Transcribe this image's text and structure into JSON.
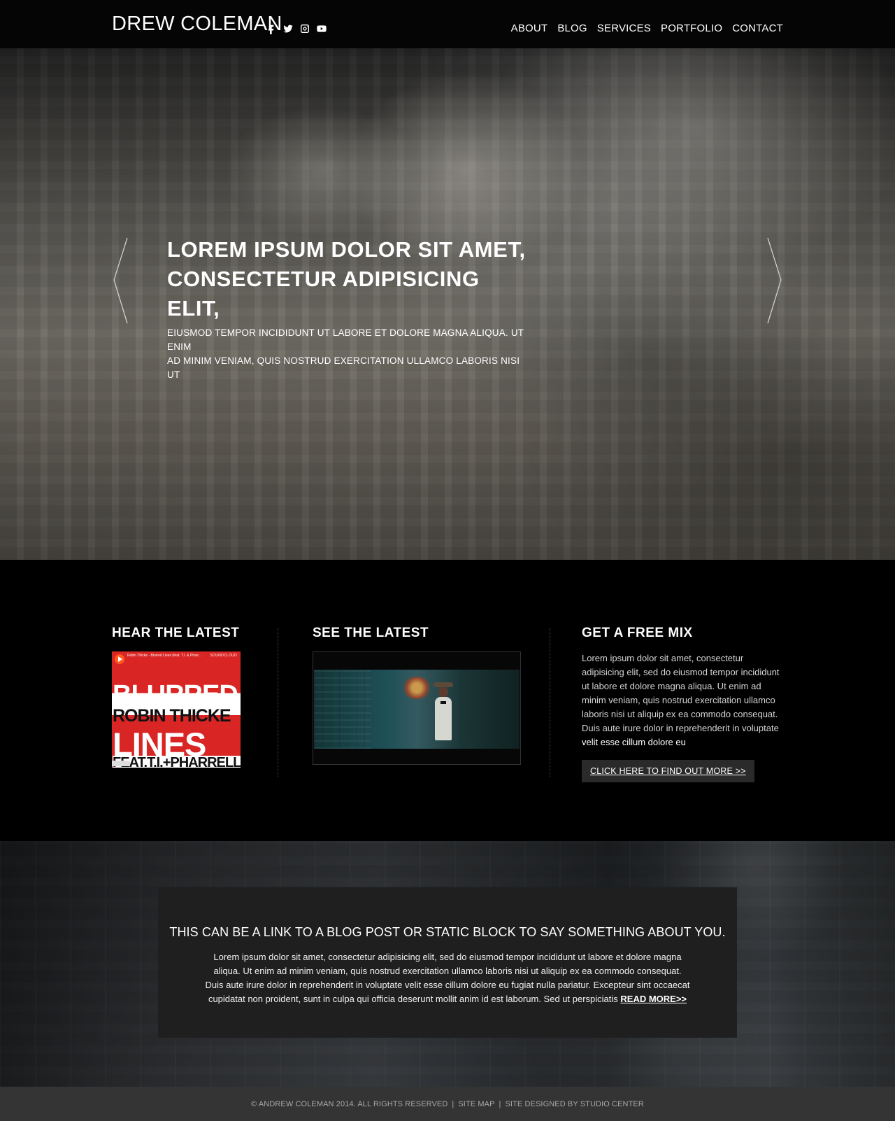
{
  "header": {
    "brand": "DREW COLEMAN",
    "social": [
      {
        "name": "facebook",
        "icon": "facebook-icon"
      },
      {
        "name": "twitter",
        "icon": "twitter-icon"
      },
      {
        "name": "instagram",
        "icon": "instagram-icon"
      },
      {
        "name": "youtube",
        "icon": "youtube-icon"
      }
    ],
    "nav": [
      "ABOUT",
      "BLOG",
      "SERVICES",
      "PORTFOLIO",
      "CONTACT"
    ]
  },
  "hero": {
    "title_line_1": "LOREM IPSUM DOLOR SIT AMET,",
    "title_line_2": "CONSECTETUR ADIPISICING ELIT,",
    "subtitle_line_1": "EIUSMOD TEMPOR INCIDIDUNT UT LABORE ET DOLORE MAGNA ALIQUA. UT ENIM",
    "subtitle_line_2": "AD MINIM VENIAM, QUIS NOSTRUD EXERCITATION ULLAMCO LABORIS NISI UT",
    "left_arrow_icon": "chevron-left-icon",
    "right_arrow_icon": "chevron-right-icon"
  },
  "latest": {
    "hear": {
      "title": "HEAR THE LATEST",
      "player_meta": "Robin Thicke - Blurred Lines (feat. T.I. & Pharr...",
      "player_brand": "SOUNDCLOUD",
      "art_line_1": "BLURRED",
      "art_line_2": "ROBIN THICKE",
      "art_line_3": "LINES",
      "art_line_4": "feat.T.I.+PHARRELL"
    },
    "see": {
      "title": "SEE THE LATEST"
    },
    "mix": {
      "title": "GET A FREE MIX",
      "text_main": "Lorem ipsum dolor sit amet, consectetur adipisicing elit, sed do eiusmod tempor incididunt ut labore et dolore magna aliqua. Ut enim ad minim veniam, quis nostrud exercitation ullamco laboris nisi ut aliquip ex ea commodo consequat. Duis aute irure dolor in reprehenderit in voluptate",
      "text_highlight": "velit esse cillum dolore eu",
      "button_label": "CLICK HERE TO FIND OUT MORE >>"
    }
  },
  "feature": {
    "title": "THIS CAN BE A LINK TO A BLOG POST OR STATIC BLOCK TO SAY SOMETHING ABOUT YOU.",
    "text": "Lorem ipsum dolor sit amet, consectetur adipisicing elit, sed do eiusmod tempor incididunt ut labore et dolore magna aliqua. Ut enim ad minim veniam, quis nostrud exercitation ullamco laboris nisi ut aliquip ex ea commodo consequat. Duis aute irure dolor in reprehenderit in voluptate velit esse cillum dolore eu fugiat nulla pariatur. Excepteur sint occaecat cupidatat non proident, sunt in culpa qui officia deserunt mollit anim id est laborum. Sed ut perspiciatis",
    "read_more": "READ MORE>>"
  },
  "footer": {
    "copyright": "© ANDREW COLEMAN 2014. ALL RIGHTS RESERVED",
    "separator_1": "|",
    "site_map": "SITE MAP",
    "separator_2": "|",
    "designed_by": "SITE DESIGNED BY STUDIO CENTER"
  }
}
